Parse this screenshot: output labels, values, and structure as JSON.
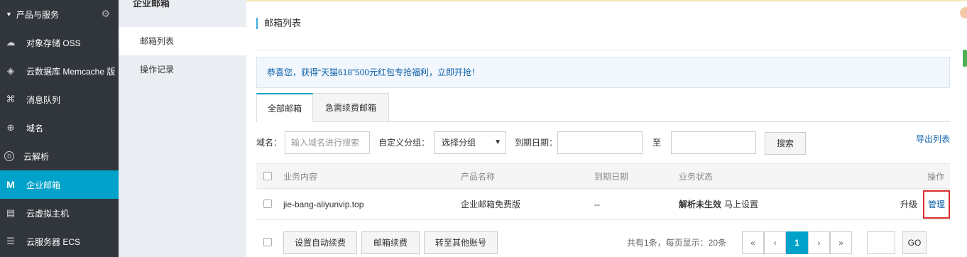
{
  "sidebar": {
    "header": "产品与服务",
    "items": [
      {
        "label": "对象存储 OSS",
        "icon": "cloud-upload-icon"
      },
      {
        "label": "云数据库 Memcache 版",
        "icon": "layers-icon"
      },
      {
        "label": "消息队列",
        "icon": "network-icon"
      },
      {
        "label": "域名",
        "icon": "globe-icon"
      },
      {
        "label": "云解析",
        "icon": "dns-icon"
      },
      {
        "label": "企业邮箱",
        "icon": "mail-m-icon"
      },
      {
        "label": "云虚拟主机",
        "icon": "server-icon"
      },
      {
        "label": "云服务器 ECS",
        "icon": "server-stack-icon"
      }
    ]
  },
  "subnav": {
    "title": "企业邮箱",
    "items": [
      "邮箱列表",
      "操作记录"
    ]
  },
  "main": {
    "title": "邮箱列表",
    "notice": "恭喜您，获得“天猫618”500元红包专抢福利，立即开抢！",
    "tabs": [
      "全部邮箱",
      "急需续费邮箱"
    ],
    "filter": {
      "domain_label": "域名：",
      "domain_placeholder": "输入域名进行搜索",
      "group_label": "自定义分组：",
      "group_value": "选择分组",
      "date_label": "到期日期：",
      "to_label": "至",
      "search_button": "搜索",
      "export_link": "导出列表"
    },
    "table": {
      "headers": [
        "业务内容",
        "产品名称",
        "到期日期",
        "业务状态",
        "操作"
      ],
      "rows": [
        {
          "content": "jie-bang-aliyunvip.top",
          "product": "企业邮箱免费版",
          "expiry": "--",
          "status": "解析未生效",
          "status_action": "马上设置",
          "op_upgrade": "升级",
          "op_manage": "管理"
        }
      ]
    },
    "footer": {
      "auto_renew": "设置自动续费",
      "renew": "邮箱续费",
      "transfer": "转至其他账号",
      "summary": "共有1条，每页显示：20条",
      "pages": [
        "«",
        "‹",
        "1",
        "›",
        "»"
      ],
      "go": "GO"
    }
  }
}
